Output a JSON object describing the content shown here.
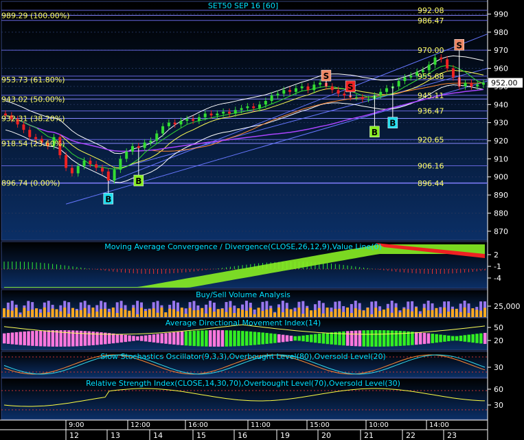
{
  "colors": {
    "bg_top": "#000000",
    "bg_bottom": "#0b2f66",
    "title": "#00e0ff",
    "axis_text": "#ffffff",
    "fib_text": "#ffff66",
    "price_line": "#ffffff",
    "up_candle": "#33dd33",
    "down_candle": "#ee2222",
    "buy_cyan": "#22ddee",
    "buy_green": "#88ee22",
    "sell_red": "#ee2222",
    "sell_salmon": "#ee8866",
    "pink": "#ff77dd",
    "green": "#33ee22",
    "volume_orange": "#ffaa22",
    "volume_purple": "#9977ee"
  },
  "chart_data": [
    {
      "type": "candlestick",
      "title": "SET50 SEP 16  [60]",
      "ylim": [
        865,
        997
      ],
      "y_ticks": [
        870,
        880,
        890,
        900,
        910,
        920,
        930,
        940,
        950,
        960,
        970,
        980,
        990
      ],
      "last_price": "952.00",
      "fib_levels": [
        {
          "value": 989.29,
          "label": "989.29 (100.00%)"
        },
        {
          "value": 953.73,
          "label": "953.73 (61.80%)"
        },
        {
          "value": 943.02,
          "label": "943.02 (50.00%)"
        },
        {
          "value": 932.31,
          "label": "932.31 (38.20%)"
        },
        {
          "value": 918.54,
          "label": "918.54 (23.60%)"
        },
        {
          "value": 896.74,
          "label": "896.74 (0.00%)"
        }
      ],
      "levels": [
        {
          "value": 992.08,
          "label": "992.08"
        },
        {
          "value": 986.47,
          "label": "986.47"
        },
        {
          "value": 970.0,
          "label": "970.00"
        },
        {
          "value": 955.68,
          "label": "955.68"
        },
        {
          "value": 945.11,
          "label": "945.11"
        },
        {
          "value": 936.47,
          "label": "936.47"
        },
        {
          "value": 920.65,
          "label": "920.65"
        },
        {
          "value": 906.16,
          "label": "906.16"
        },
        {
          "value": 896.44,
          "label": "896.44"
        }
      ],
      "close": [
        934,
        932,
        929,
        926,
        922,
        921,
        919,
        917,
        922,
        912,
        905,
        902,
        906,
        909,
        907,
        905,
        903,
        898,
        904,
        910,
        914,
        917,
        916,
        919,
        920,
        924,
        928,
        930,
        929,
        931,
        932,
        931,
        933,
        935,
        934,
        935,
        936,
        935,
        937,
        938,
        939,
        938,
        940,
        942,
        945,
        946,
        948,
        947,
        949,
        950,
        948,
        951,
        952,
        950,
        948,
        946,
        945,
        944,
        944,
        943,
        943,
        945,
        947,
        949,
        950,
        953,
        955,
        956,
        958,
        959,
        962,
        966,
        965,
        960,
        955,
        950,
        952,
        950,
        951,
        952
      ],
      "signals": [
        {
          "index": 17,
          "label": "B",
          "kind": "buy_cyan",
          "price": 888
        },
        {
          "index": 22,
          "label": "B",
          "kind": "buy_green",
          "price": 898
        },
        {
          "index": 53,
          "label": "S",
          "kind": "sell_salmon",
          "price": 956
        },
        {
          "index": 57,
          "label": "S",
          "kind": "sell_red",
          "price": 950
        },
        {
          "index": 61,
          "label": "B",
          "kind": "buy_green",
          "price": 925
        },
        {
          "index": 64,
          "label": "B",
          "kind": "buy_cyan",
          "price": 930
        },
        {
          "index": 75,
          "label": "S",
          "kind": "sell_salmon",
          "price": 973
        }
      ]
    },
    {
      "type": "histogram",
      "title": "Moving Average Convergence / Divergence(CLOSE,26,12,9),Value Line(0)",
      "y_ticks": [
        "2",
        "-1",
        "-4"
      ]
    },
    {
      "type": "bar",
      "title": "Buy/Sell Volume Analysis",
      "y_ticks": [
        "25,000"
      ]
    },
    {
      "type": "area",
      "title": "Average Directional Movement Index(14)",
      "y_ticks": [
        "50",
        "20"
      ]
    },
    {
      "type": "line",
      "title": "Slow Stochastics Oscillator(9,3,3),Overbought Level(80),Oversold Level(20)",
      "y_ticks": [
        "30"
      ]
    },
    {
      "type": "line",
      "title": "Relative Strength Index(CLOSE,14,30,70),Overbought Level(70),Oversold Level(30)",
      "y_ticks": [
        "60",
        "30"
      ]
    }
  ],
  "time_axis": {
    "times": [
      "9:00",
      "12:00",
      "16:00",
      "11:00",
      "15:00",
      "10:00",
      "14:00"
    ],
    "days": [
      "12",
      "13",
      "14",
      "15",
      "16",
      "19",
      "20",
      "21",
      "22",
      "23"
    ]
  }
}
